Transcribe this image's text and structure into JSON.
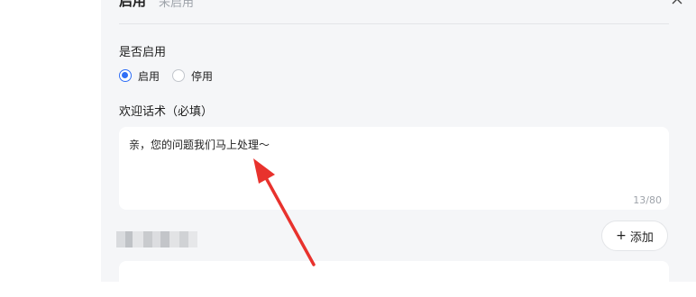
{
  "header": {
    "title": "启用",
    "subtitle": "未启用",
    "close_icon": "close-icon"
  },
  "enable_section": {
    "label": "是否启用",
    "options": [
      {
        "label": "启用",
        "checked": true
      },
      {
        "label": "停用",
        "checked": false
      }
    ]
  },
  "greeting_section": {
    "label": "欢迎话术（必填）",
    "value": "亲，您的问题我们马上处理～",
    "counter": "13/80"
  },
  "add_button": {
    "label": "添加",
    "icon": "plus-icon"
  },
  "colors": {
    "accent": "#2f6ef6",
    "panel_bg": "#f5f6f8",
    "annotation_arrow": "#e8322d"
  }
}
